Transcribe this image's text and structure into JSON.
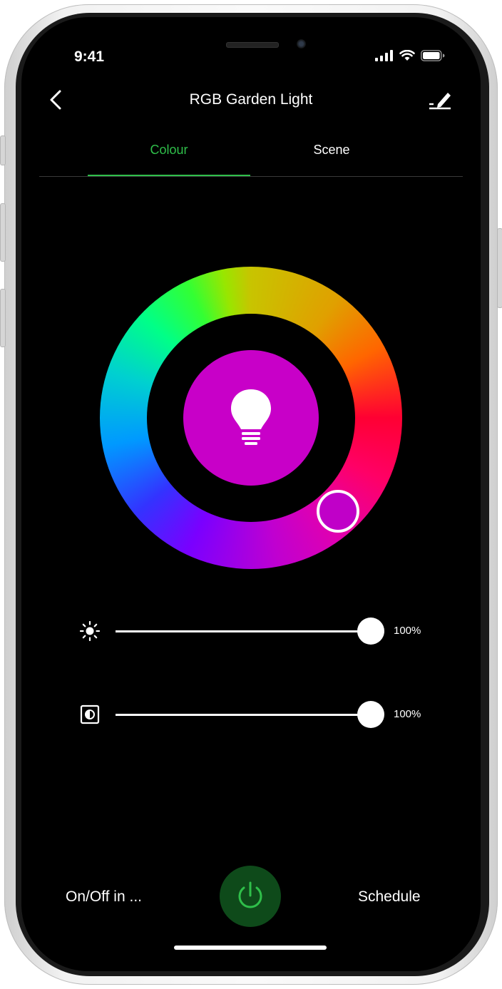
{
  "status_bar": {
    "time": "9:41"
  },
  "header": {
    "title": "RGB Garden Light"
  },
  "tabs": [
    {
      "label": "Colour",
      "active": true
    },
    {
      "label": "Scene",
      "active": false
    }
  ],
  "color_wheel": {
    "selected_color": "#c800c8"
  },
  "sliders": [
    {
      "name": "brightness",
      "value_label": "100%",
      "fraction": 1.0
    },
    {
      "name": "contrast",
      "value_label": "100%",
      "fraction": 1.0
    }
  ],
  "bottom_bar": {
    "left_label": "On/Off in ...",
    "right_label": "Schedule"
  },
  "colors": {
    "accent": "#2fbf4a",
    "power_bg": "#0e4a1a"
  }
}
